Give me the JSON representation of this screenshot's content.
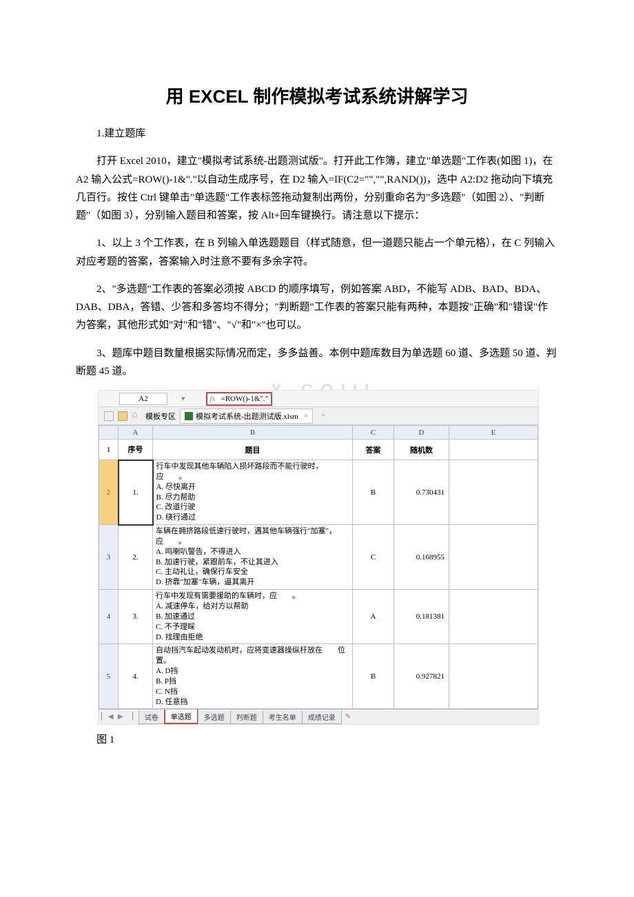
{
  "title": "用 EXCEL 制作模拟考试系统讲解学习",
  "p1": "1.建立题库",
  "p2": "打开 Excel 2010，建立\"模拟考试系统-出题测试版\"。打开此工作簿，建立\"单选题\"工作表(如图 1)，在 A2 输入公式=ROW()-1&\".\"以自动生成序号，在 D2 输入=IF(C2=\"\",\"\",RAND())，选中 A2:D2 拖动向下填充几百行。按住 Ctrl 键单击\"单选题\"工作表标签拖动复制出两份，分别重命名为\"多选题\"（如图 2）、\"判断题\"（如图 3），分别输入题目和答案，按 Alt+回车键换行。请注意以下提示：",
  "p3": "1、以上 3 个工作表，在 B 列输入单选题题目（样式随意，但一道题只能占一个单元格），在 C 列输入对应考题的答案，答案输入时注意不要有多余字符。",
  "p4": "2、\"多选题\"工作表的答案必须按 ABCD 的顺序填写，例如答案 ABD，不能写 ADB、BAD、BDA、DAB、DBA，答错、少答和多答均不得分；\"判断题\"工作表的答案只能有两种，本题按\"正确\"和\"错误\"作为答案，其他形式如\"对\"和\"错\"、\"√\"和\"×\"也可以。",
  "p5": "3、题库中题目数量根据实际情况而定，多多益善。本例中题库数目为单选题 60 道、多选题 50 道、判断题 45 道。",
  "watermark": "X . C O I I I",
  "fbar": {
    "cellref": "A2",
    "fx": "fx",
    "formula": "=ROW()-1&\".\""
  },
  "tabbar": {
    "template": "模板专区",
    "doc": "模拟考试系统-出题测试版.xlsm",
    "close": "×",
    "plus": "+"
  },
  "cols": [
    "A",
    "B",
    "C",
    "D",
    "E"
  ],
  "headers": {
    "A": "序号",
    "B": "题目",
    "C": "答案",
    "D": "随机数",
    "E": ""
  },
  "rows": [
    {
      "rownum": "2",
      "num": "1.",
      "body": "行车中发现其他车辆陷入损坏路段而不能行驶时，应　　。\nA. 尽快离开\nB. 尽力帮助\nC. 改道行驶\nD. 绕行通过",
      "ans": "B",
      "rand": "0.730431"
    },
    {
      "rownum": "3",
      "num": "2.",
      "body": "车辆在拥挤路段低速行驶时，遇其他车辆强行\"加塞\"，应　　。\nA. 鸣喇叭警告，不得进入\nB. 加速行驶，紧跟前车，不让其进入\nC. 主动礼让，确保行车安全\nD. 挤靠\"加塞\"车辆，逼其离开",
      "ans": "C",
      "rand": "0.168955"
    },
    {
      "rownum": "4",
      "num": "3.",
      "body": "行车中发现有需要援助的车辆时，应　　。\nA. 减速停车，给对方以帮助\nB. 加速通过\nC. 不予理睬\nD. 找理由拒绝",
      "ans": "A",
      "rand": "0.181381"
    },
    {
      "rownum": "5",
      "num": "4.",
      "body": "自动挡汽车起动发动机时，应将变速器操纵杆放在　　位置。\nA. D挡\nB. P挡\nC. N挡\nD. 任意挡",
      "ans": "B",
      "rand": "0.927821"
    }
  ],
  "sheets": {
    "nav": "▏◀ ▶ ▕",
    "tabs": [
      "试卷",
      "单选题",
      "多选题",
      "判断题",
      "考生名单",
      "成绩记录"
    ],
    "active": "单选题",
    "addicon": "✎"
  },
  "caption": "图 1"
}
